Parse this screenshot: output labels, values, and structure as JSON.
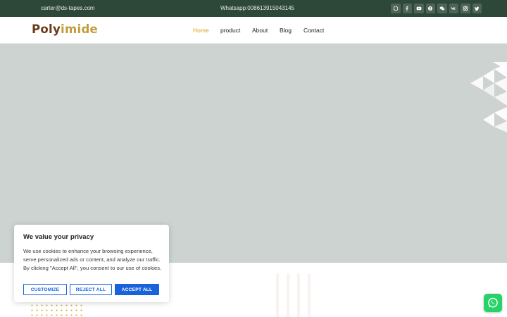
{
  "topbar": {
    "email": "carter@ds-tapes.com",
    "phone": "Whatsapp:008613915043145",
    "social_icons": [
      "whatsapp-icon",
      "facebook-icon",
      "youtube-icon",
      "skype-icon",
      "wechat-icon",
      "vk-icon",
      "instagram-icon",
      "twitter-icon"
    ]
  },
  "header": {
    "logo_part1": "Poly",
    "logo_part2": "imide",
    "nav": [
      {
        "label": "Home",
        "active": true
      },
      {
        "label": "product",
        "active": false
      },
      {
        "label": "About",
        "active": false
      },
      {
        "label": "Blog",
        "active": false
      },
      {
        "label": "Contact",
        "active": false
      }
    ]
  },
  "cookie": {
    "title": "We value your privacy",
    "body": "We use cookies to enhance your browsing experience, serve personalized ads or content, and analyze our traffic. By clicking \"Accept All\", you consent to our use of cookies.",
    "customize": "CUSTOMIZE",
    "reject": "REJECT ALL",
    "accept": "ACCEPT ALL"
  },
  "colors": {
    "topbar_bg": "#2d4739",
    "nav_active": "#d6a21e",
    "hero_bg": "#ccd3d1",
    "cookie_accent": "#1863dc",
    "whatsapp": "#25d366"
  }
}
